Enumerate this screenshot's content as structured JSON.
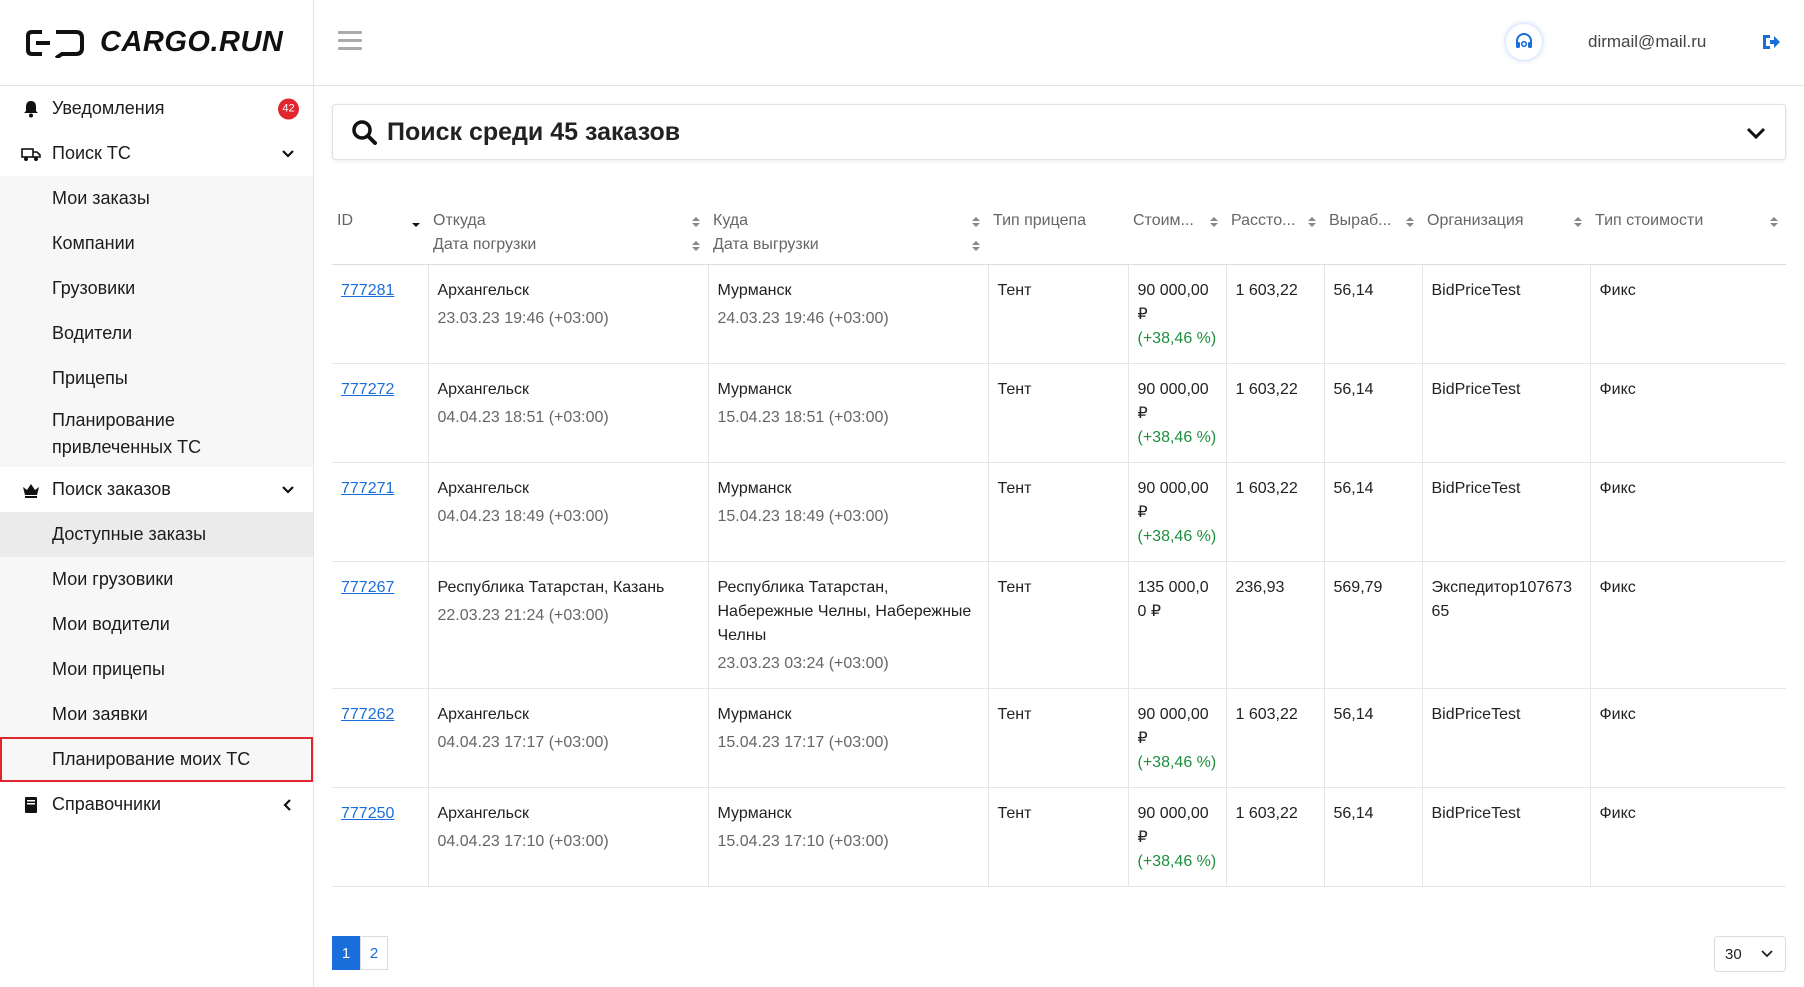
{
  "brand": {
    "name": "CARGO.RUN"
  },
  "header": {
    "user_email": "dirmail@mail.ru"
  },
  "sidebar": {
    "items": [
      {
        "label": "Уведомления",
        "badge": "42"
      },
      {
        "label": "Поиск ТС"
      },
      {
        "label": "Мои заказы"
      },
      {
        "label": "Компании"
      },
      {
        "label": "Грузовики"
      },
      {
        "label": "Водители"
      },
      {
        "label": "Прицепы"
      },
      {
        "label": "Планирование привлеченных ТС"
      },
      {
        "label": "Поиск заказов"
      },
      {
        "label": "Доступные заказы"
      },
      {
        "label": "Мои грузовики"
      },
      {
        "label": "Мои водители"
      },
      {
        "label": "Мои прицепы"
      },
      {
        "label": "Мои заявки"
      },
      {
        "label": "Планирование моих ТС"
      },
      {
        "label": "Справочники"
      }
    ]
  },
  "search": {
    "title": "Поиск среди 45 заказов"
  },
  "table": {
    "headers": {
      "id": "ID",
      "from": "Откуда",
      "load_date": "Дата погрузки",
      "to": "Куда",
      "unload_date": "Дата выгрузки",
      "trailer": "Тип прицепа",
      "cost": "Стоим...",
      "distance": "Рассто...",
      "output": "Выраб...",
      "org": "Организация",
      "cost_type": "Тип стоимости"
    },
    "rows": [
      {
        "id": "777281",
        "from": "Архангельск",
        "load_date": "23.03.23 19:46 (+03:00)",
        "to": "Мурманск",
        "unload_date": "24.03.23 19:46 (+03:00)",
        "trailer": "Тент",
        "cost": "90 000,00 ₽",
        "cost_delta": "(+38,46 %)",
        "distance": "1 603,22",
        "output": "56,14",
        "org": "BidPriceTest",
        "cost_type": "Фикс"
      },
      {
        "id": "777272",
        "from": "Архангельск",
        "load_date": "04.04.23 18:51 (+03:00)",
        "to": "Мурманск",
        "unload_date": "15.04.23 18:51 (+03:00)",
        "trailer": "Тент",
        "cost": "90 000,00 ₽",
        "cost_delta": "(+38,46 %)",
        "distance": "1 603,22",
        "output": "56,14",
        "org": "BidPriceTest",
        "cost_type": "Фикс"
      },
      {
        "id": "777271",
        "from": "Архангельск",
        "load_date": "04.04.23 18:49 (+03:00)",
        "to": "Мурманск",
        "unload_date": "15.04.23 18:49 (+03:00)",
        "trailer": "Тент",
        "cost": "90 000,00 ₽",
        "cost_delta": "(+38,46 %)",
        "distance": "1 603,22",
        "output": "56,14",
        "org": "BidPriceTest",
        "cost_type": "Фикс"
      },
      {
        "id": "777267",
        "from": "Республика Татарстан, Казань",
        "load_date": "22.03.23 21:24 (+03:00)",
        "to": "Республика Татарстан, Набережные Челны, Набережные Челны",
        "unload_date": "23.03.23 03:24 (+03:00)",
        "trailer": "Тент",
        "cost": "135 000,00 ₽",
        "cost_delta": "",
        "distance": "236,93",
        "output": "569,79",
        "org": "Экспедитор10767365",
        "cost_type": "Фикс"
      },
      {
        "id": "777262",
        "from": "Архангельск",
        "load_date": "04.04.23 17:17 (+03:00)",
        "to": "Мурманск",
        "unload_date": "15.04.23 17:17 (+03:00)",
        "trailer": "Тент",
        "cost": "90 000,00 ₽",
        "cost_delta": "(+38,46 %)",
        "distance": "1 603,22",
        "output": "56,14",
        "org": "BidPriceTest",
        "cost_type": "Фикс"
      },
      {
        "id": "777250",
        "from": "Архангельск",
        "load_date": "04.04.23 17:10 (+03:00)",
        "to": "Мурманск",
        "unload_date": "15.04.23 17:10 (+03:00)",
        "trailer": "Тент",
        "cost": "90 000,00 ₽",
        "cost_delta": "(+38,46 %)",
        "distance": "1 603,22",
        "output": "56,14",
        "org": "BidPriceTest",
        "cost_type": "Фикс"
      }
    ]
  },
  "pagination": {
    "pages": [
      "1",
      "2"
    ],
    "current": "1",
    "per_page": "30"
  },
  "colors": {
    "accent": "#1a6edb",
    "badge": "#e0262f",
    "delta": "#1e8f3e",
    "highlight": "#e0262f"
  }
}
